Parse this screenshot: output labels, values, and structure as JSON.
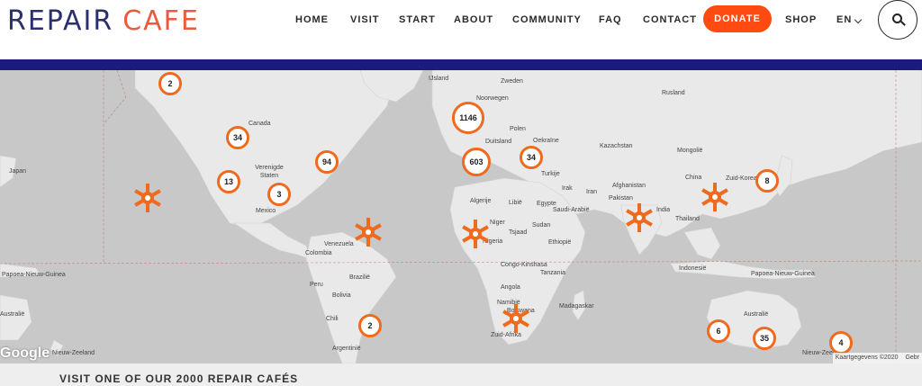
{
  "brand": {
    "repair": "REPAIR",
    "cafe": "CAFE",
    "primary": "#2b2f6e",
    "accent": "#ea5a3b"
  },
  "nav": {
    "items": [
      "HOME",
      "VISIT",
      "START",
      "ABOUT",
      "COMMUNITY",
      "FAQ",
      "CONTACT"
    ],
    "donate": "DONATE",
    "shop": "SHOP",
    "lang": "EN"
  },
  "colors": {
    "navy_bar": "#1b1a7e",
    "donate": "#ff4a12",
    "marker": "#f06a1e",
    "sea": "#c8c8c8",
    "land": "#e9e9e9"
  },
  "icons": {
    "search": "search-icon",
    "chevron": "chevron-down-icon",
    "marker": "repair-cafe-marker-icon"
  },
  "map": {
    "labels": [
      "IJsland",
      "Zweden",
      "Noorwegen",
      "Rusland",
      "Canada",
      "Polen",
      "Duitsland",
      "Oekraïne",
      "Kazachstan",
      "Mongolië",
      "Verenigde Staten",
      "Turkije",
      "China",
      "Zuid-Korea",
      "Japan",
      "Algerije",
      "Libië",
      "Irak",
      "Iran",
      "Afghanistan",
      "Pakistan",
      "Egypte",
      "Saudi-Arabië",
      "Mexico",
      "Niger",
      "Sudan",
      "India",
      "Thailand",
      "Venezuela",
      "Colombia",
      "Nigeria",
      "Tsjaad",
      "Ethiopië",
      "Papoea-Nieuw-Guinea",
      "Indonesië",
      "Papoea-Nieuw-Guinea",
      "Brazilië",
      "Peru",
      "Bolivia",
      "Congo-Kinshasa",
      "Tanzania",
      "Angola",
      "Namibië",
      "Botswana",
      "Madagaskar",
      "Australië",
      "Australië",
      "Chili",
      "Argentinië",
      "Zuid-Afrika",
      "Nieuw-Zeeland",
      "Nieuw-Zeeland"
    ],
    "clusters": [
      "2",
      "34",
      "94",
      "13",
      "3",
      "1146",
      "603",
      "34",
      "8",
      "2",
      "6",
      "35",
      "4"
    ],
    "attribution": "Kaartgegevens ©2020",
    "attribution_more": "Gebr",
    "google": "Google"
  },
  "footer": {
    "title": "VISIT ONE OF OUR 2000 REPAIR CAFÉS"
  }
}
